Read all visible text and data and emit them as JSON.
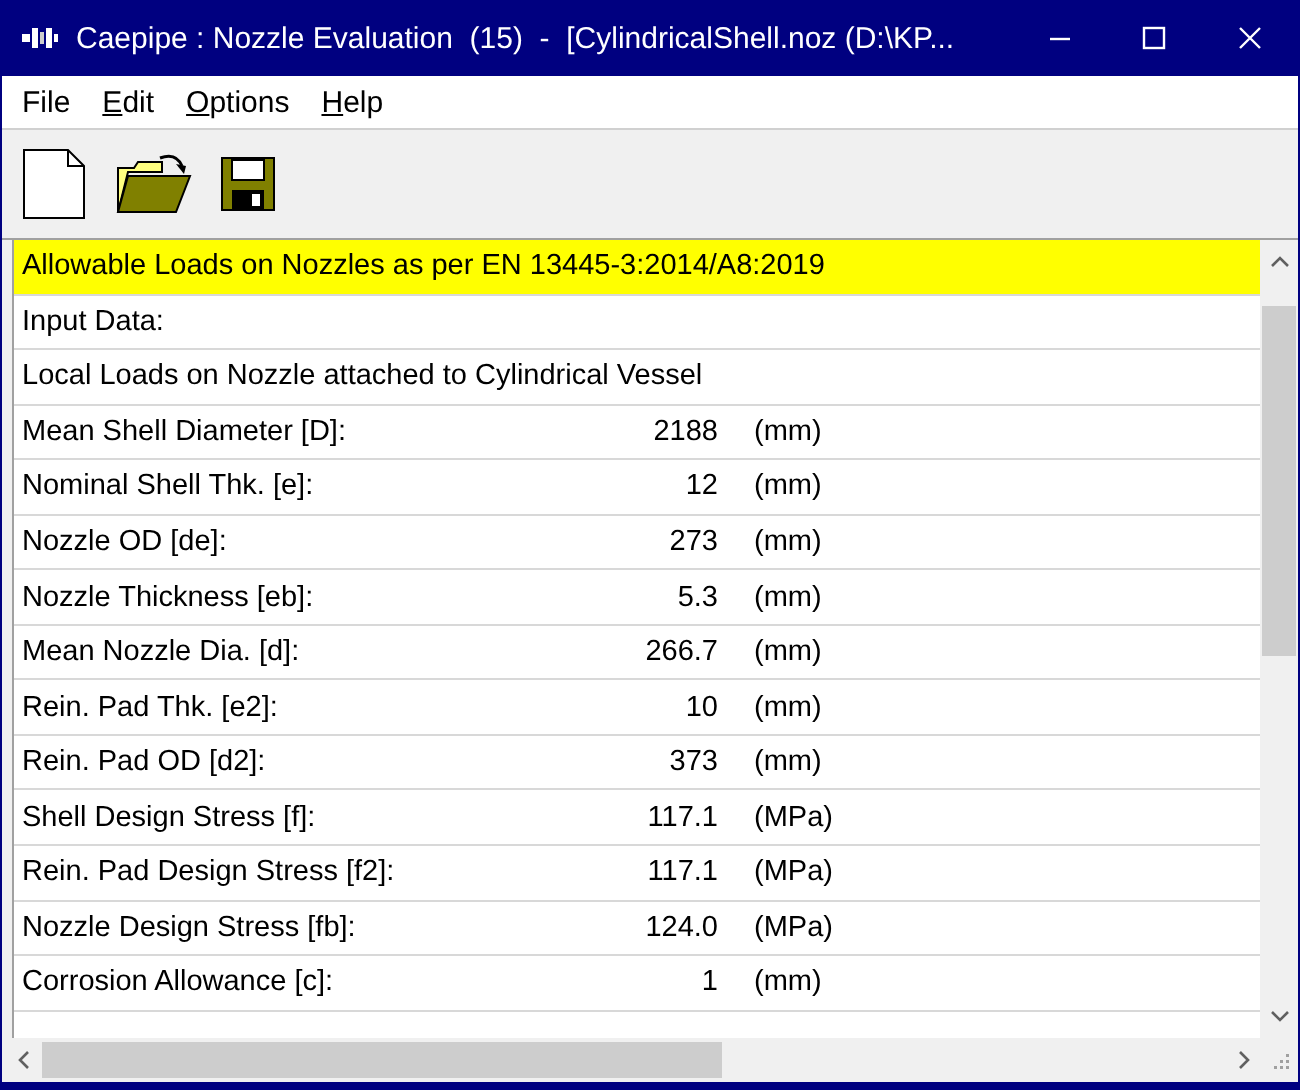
{
  "window": {
    "title": "Caepipe : Nozzle Evaluation  (15)  -  [CylindricalShell.noz (D:\\KP..."
  },
  "menu": [
    {
      "label": "File",
      "underlined_first_letter": false
    },
    {
      "label": "Edit",
      "underlined_first_letter": true
    },
    {
      "label": "Options",
      "underlined_first_letter": true
    },
    {
      "label": "Help",
      "underlined_first_letter": true
    }
  ],
  "rows": [
    {
      "kind": "highlight",
      "label": "Allowable Loads on Nozzles as per EN 13445-3:2014/A8:2019"
    },
    {
      "kind": "text",
      "label": "Input Data:"
    },
    {
      "kind": "text",
      "label": "Local Loads on Nozzle attached to Cylindrical Vessel"
    },
    {
      "kind": "param",
      "label": "Mean Shell Diameter [D]:",
      "value": "2188",
      "unit": "(mm)"
    },
    {
      "kind": "param",
      "label": "Nominal Shell Thk. [e]:",
      "value": "12",
      "unit": "(mm)"
    },
    {
      "kind": "param",
      "label": "Nozzle OD [de]:",
      "value": "273",
      "unit": "(mm)"
    },
    {
      "kind": "param",
      "label": "Nozzle Thickness [eb]:",
      "value": "5.3",
      "unit": "(mm)"
    },
    {
      "kind": "param",
      "label": "Mean Nozzle Dia. [d]:",
      "value": "266.7",
      "unit": "(mm)"
    },
    {
      "kind": "param",
      "label": "Rein. Pad Thk. [e2]:",
      "value": "10",
      "unit": "(mm)"
    },
    {
      "kind": "param",
      "label": "Rein. Pad OD [d2]:",
      "value": "373",
      "unit": "(mm)"
    },
    {
      "kind": "param",
      "label": "Shell Design Stress [f]:",
      "value": "117.1",
      "unit": "(MPa)"
    },
    {
      "kind": "param",
      "label": "Rein. Pad Design Stress [f2]:",
      "value": "117.1",
      "unit": "(MPa)"
    },
    {
      "kind": "param",
      "label": "Nozzle Design Stress [fb]:",
      "value": "124.0",
      "unit": "(MPa)"
    },
    {
      "kind": "param",
      "label": "Corrosion Allowance [c]:",
      "value": "1",
      "unit": "(mm)"
    }
  ]
}
